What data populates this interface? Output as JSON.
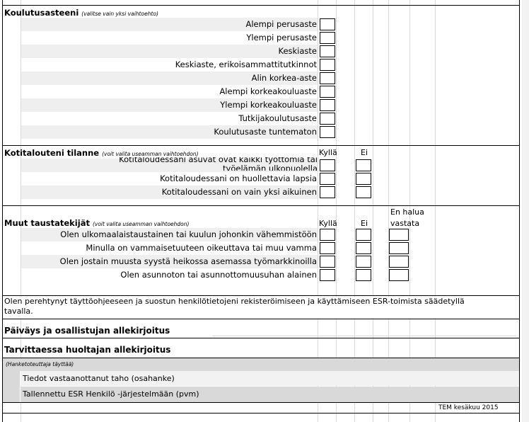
{
  "education": {
    "title": "Koulutusasteeni",
    "note": "(valitse vain yksi vaihtoehto)",
    "options": [
      "Alempi perusaste",
      "Ylempi perusaste",
      "Keskiaste",
      "Keskiaste, erikoisammattitutkinnot",
      "Alin korkea-aste",
      "Alempi korkeakouluaste",
      "Ylempi korkeakouluaste",
      "Tutkijakoulutusaste",
      "Koulutusaste tuntematon"
    ]
  },
  "household": {
    "title": "Kotitalouteni tilanne",
    "note": "(voit valita useamman vaihtoehdon)",
    "col_yes": "Kyllä",
    "col_no": "Ei",
    "options": [
      "Kotitaloudessani asuvat ovat kaikki työttömiä tai työelämän ulkopuolella",
      "Kotitaloudessani on huollettavia lapsia",
      "Kotitaloudessani on vain yksi aikuinen"
    ]
  },
  "background": {
    "title": "Muut taustatekijät",
    "note": "(voit valita useamman vaihtoehdon)",
    "col_yes": "Kyllä",
    "col_no": "Ei",
    "col_decline_1": "En halua",
    "col_decline_2": "vastata",
    "options": [
      "Olen ulkomaalaistaustainen tai kuulun johonkin  vähemmistöön",
      "Minulla on vammaisetuuteen oikeuttava tai muu vamma",
      "Olen jostain muusta syystä heikossa asemassa työmarkkinoilla",
      "Olen asunnoton tai asunnottomuusuhan alainen"
    ]
  },
  "consent": {
    "line1": "Olen perehtynyt täyttöohjeeseen ja suostun henkilötietojeni rekisteröimiseen ja käyttämiseen ESR-toimista säädetyllä",
    "line2": "tavalla."
  },
  "signatures": {
    "participant": "Päiväys ja osallistujan allekirjoitus",
    "guardian": "Tarvittaessa huoltajan allekirjoitus"
  },
  "project": {
    "note": "(Hanketoteuttaja täyttää)",
    "rows": [
      "Tiedot vastaanottanut taho (osahanke)",
      "Tallennettu ESR Henkilö -järjestelmään (pvm)"
    ]
  },
  "footer": {
    "version": "TEM kesäkuu 2015"
  }
}
